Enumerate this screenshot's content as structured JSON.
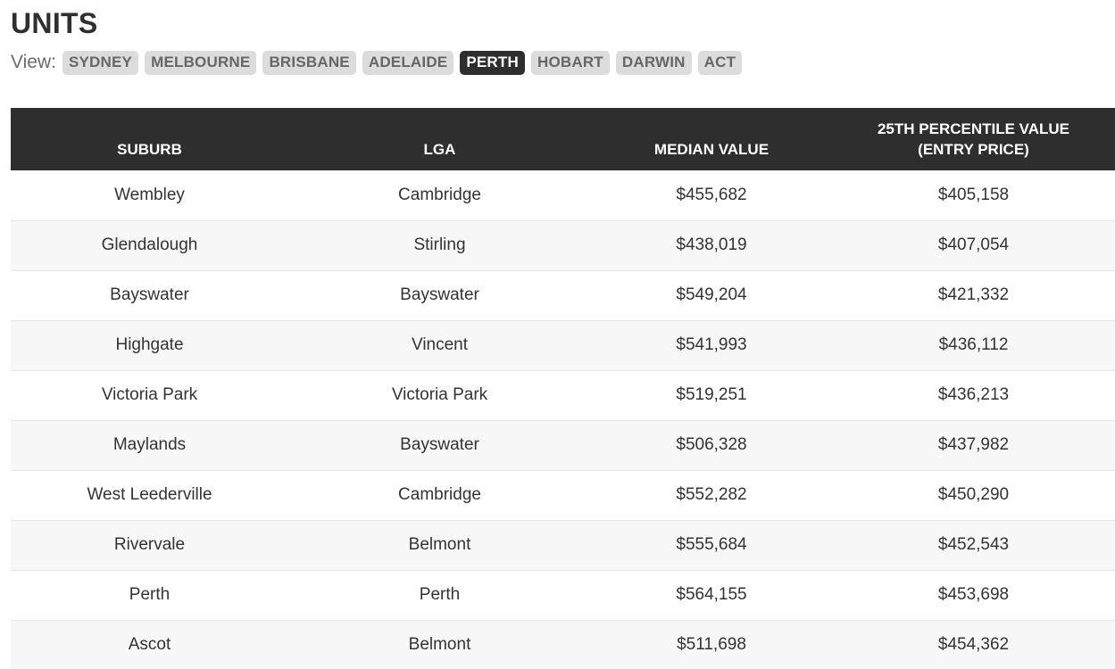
{
  "heading": "UNITS",
  "view": {
    "label": "View:",
    "options": [
      {
        "label": "SYDNEY",
        "active": false
      },
      {
        "label": "MELBOURNE",
        "active": false
      },
      {
        "label": "BRISBANE",
        "active": false
      },
      {
        "label": "ADELAIDE",
        "active": false
      },
      {
        "label": "PERTH",
        "active": true
      },
      {
        "label": "HOBART",
        "active": false
      },
      {
        "label": "DARWIN",
        "active": false
      },
      {
        "label": "ACT",
        "active": false
      }
    ]
  },
  "table": {
    "columns": [
      "SUBURB",
      "LGA",
      "MEDIAN VALUE",
      "25TH PERCENTILE VALUE\n(ENTRY PRICE)"
    ],
    "column_lines": [
      [
        "SUBURB"
      ],
      [
        "LGA"
      ],
      [
        "MEDIAN VALUE"
      ],
      [
        "25TH PERCENTILE VALUE",
        "(ENTRY PRICE)"
      ]
    ],
    "rows": [
      [
        "Wembley",
        "Cambridge",
        "$455,682",
        "$405,158"
      ],
      [
        "Glendalough",
        "Stirling",
        "$438,019",
        "$407,054"
      ],
      [
        "Bayswater",
        "Bayswater",
        "$549,204",
        "$421,332"
      ],
      [
        "Highgate",
        "Vincent",
        "$541,993",
        "$436,112"
      ],
      [
        "Victoria Park",
        "Victoria Park",
        "$519,251",
        "$436,213"
      ],
      [
        "Maylands",
        "Bayswater",
        "$506,328",
        "$437,982"
      ],
      [
        "West Leederville",
        "Cambridge",
        "$552,282",
        "$450,290"
      ],
      [
        "Rivervale",
        "Belmont",
        "$555,684",
        "$452,543"
      ],
      [
        "Perth",
        "Perth",
        "$564,155",
        "$453,698"
      ],
      [
        "Ascot",
        "Belmont",
        "$511,698",
        "$454,362"
      ]
    ]
  },
  "colors": {
    "header_bg": "#2e2e2e",
    "pill_bg": "#dcdcdc",
    "pill_active_bg": "#2e2e2e",
    "alt_row_bg": "#f7f7f7"
  }
}
